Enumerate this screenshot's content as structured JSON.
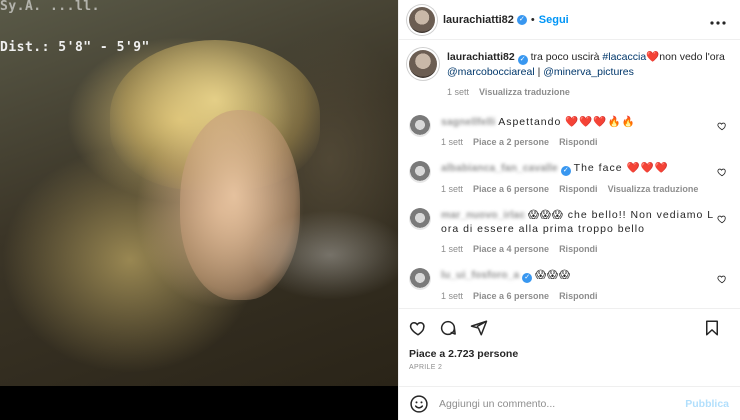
{
  "media": {
    "overlay_line1": "Sy.A. ...ll.",
    "overlay_line2": "Dist.: 5'8\" - 5'9\""
  },
  "header": {
    "username": "laurachiatti82",
    "separator": "•",
    "follow_label": "Segui",
    "more_label": "•••"
  },
  "caption": {
    "username": "laurachiatti82",
    "text_before": " tra poco uscirà ",
    "hashtag": "#lacaccia",
    "heart": "❤️",
    "text_after": "non vedo l'ora ",
    "mention1": "@marcobocciareal",
    "separator": " | ",
    "mention2": "@minerva_pictures",
    "time": "1 sett",
    "translate": "Visualizza traduzione"
  },
  "comments": [
    {
      "name": "sagnellfelli",
      "text": "Aspettando ❤️❤️❤️🔥🔥",
      "time": "1 sett",
      "likes": "Piace a 2 persone",
      "reply": "Rispondi",
      "translate": ""
    },
    {
      "name": "albabianca_fan_cavalle",
      "text": "The face ❤️❤️❤️",
      "time": "1 sett",
      "likes": "Piace a 6 persone",
      "reply": "Rispondi",
      "translate": "Visualizza traduzione"
    },
    {
      "name": "mar_nuovo_irlac",
      "text": "😱😱😱 che bello!! Non vediamo L ora di essere alla prima troppo bello",
      "time": "1 sett",
      "likes": "Piace a 4 persone",
      "reply": "Rispondi",
      "translate": ""
    },
    {
      "name": "lu_ui_fosforo_a",
      "text": "😱😱😱",
      "time": "1 sett",
      "likes": "Piace a 6 persone",
      "reply": "Rispondi",
      "translate": ""
    }
  ],
  "likes_total": "Piace a 2.723 persone",
  "date": "APRILE 2",
  "add_comment": {
    "placeholder": "Aggiungi un commento...",
    "publish": "Pubblica"
  },
  "colors": {
    "accent": "#0095f6",
    "verified": "#3897f0",
    "link": "#00376b",
    "muted": "#8e8e8e",
    "heart": "#ed4956"
  }
}
